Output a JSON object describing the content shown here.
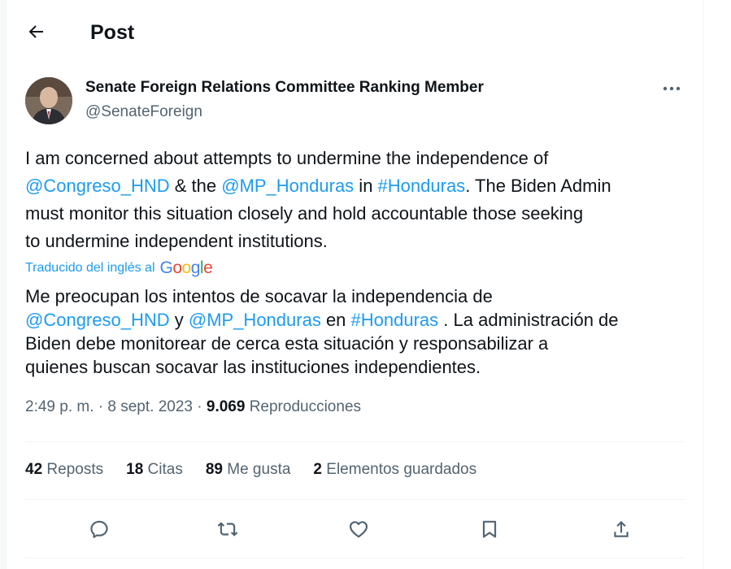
{
  "header": {
    "title": "Post"
  },
  "author": {
    "name": "Senate Foreign Relations Committee Ranking Member",
    "handle": "@SenateForeign"
  },
  "tweet": {
    "line1": "I am concerned about attempts to undermine the independence of",
    "mention1": "@Congreso_HND",
    "and": " & the ",
    "mention2": "@MP_Honduras",
    "in": " in ",
    "hashtag": "#Honduras",
    "line2_end": ". The Biden Admin",
    "line3": "must monitor this situation closely and hold accountable those seeking",
    "line4": "to undermine independent institutions."
  },
  "translation": {
    "note": "Traducido del inglés al",
    "provider": "Google",
    "line1": "Me preocupan los intentos de socavar la independencia de",
    "mention1": "@Congreso_HND",
    "y": " y ",
    "mention2": "@MP_Honduras",
    "en": " en ",
    "hashtag": "#Honduras",
    "line2_end": " . La administración de",
    "line3": "Biden debe monitorear de cerca esta situación y responsabilizar a",
    "line4": "quienes buscan socavar las instituciones independientes."
  },
  "meta": {
    "time": "2:49 p. m.",
    "sep1": " · ",
    "date": "8 sept. 2023",
    "sep2": " · ",
    "views_count": "9.069",
    "views_label": " Reproducciones"
  },
  "stats": {
    "reposts_count": "42",
    "reposts_label": " Reposts",
    "quotes_count": "18",
    "quotes_label": " Citas",
    "likes_count": "89",
    "likes_label": " Me gusta",
    "bookmarks_count": "2",
    "bookmarks_label": " Elementos guardados"
  },
  "colors": {
    "accent": "#1d9bf0",
    "text": "#0f1419",
    "muted": "#536471"
  }
}
